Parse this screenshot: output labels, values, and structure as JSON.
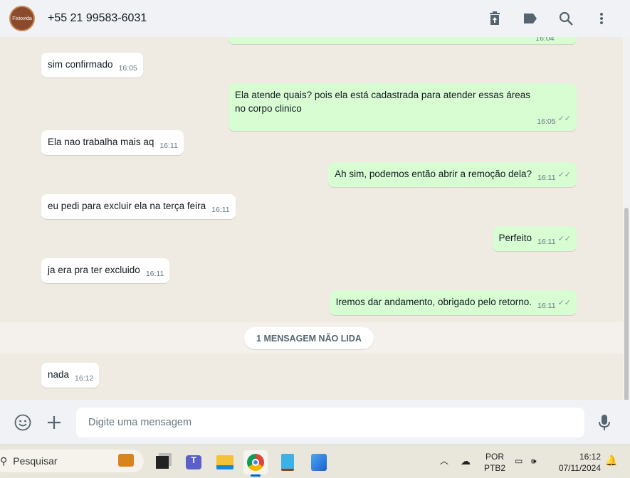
{
  "header": {
    "avatar_text": "Fisiovida",
    "contact": "+55 21 99583-6031"
  },
  "messages": [
    {
      "dir": "out",
      "text": "",
      "time": "16:04"
    },
    {
      "dir": "in",
      "text": "sim confirmado",
      "time": "16:05"
    },
    {
      "dir": "out",
      "text": "Ela atende quais? pois ela está cadastrada para atender essas áreas no corpo clinico",
      "time": "16:05"
    },
    {
      "dir": "in",
      "text": "Ela nao trabalha mais aq",
      "time": "16:11"
    },
    {
      "dir": "out",
      "text": "Ah sim, podemos então abrir a remoção dela?",
      "time": "16:11"
    },
    {
      "dir": "in",
      "text": "eu pedi para excluir ela na terça feira",
      "time": "16:11"
    },
    {
      "dir": "out",
      "text": "Perfeito",
      "time": "16:11"
    },
    {
      "dir": "in",
      "text": "ja era pra ter excluido",
      "time": "16:11"
    },
    {
      "dir": "out",
      "text": "Iremos dar andamento, obrigado pelo retorno.",
      "time": "16:11"
    },
    {
      "dir": "in",
      "text": "nada",
      "time": "16:12"
    }
  ],
  "unread_banner": "1 MENSAGEM NÃO LIDA",
  "composer": {
    "placeholder": "Digite uma mensagem"
  },
  "taskbar": {
    "search": "Pesquisar",
    "lang_top": "POR",
    "lang_bottom": "PTB2",
    "clock_time": "16:12",
    "clock_date": "07/11/2024"
  }
}
